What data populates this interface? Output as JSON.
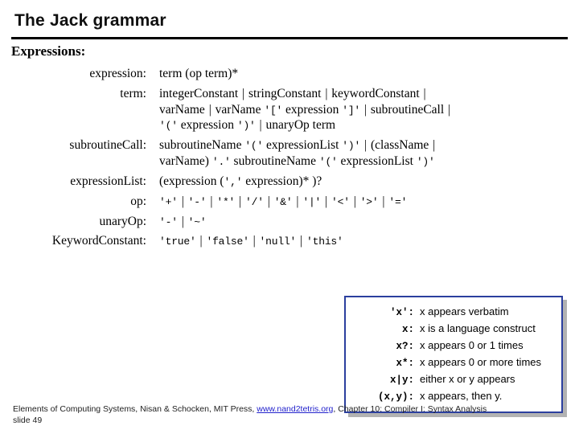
{
  "slide": {
    "title": "The Jack grammar",
    "section_heading": "Expressions:"
  },
  "grammar": {
    "rows": [
      {
        "lhs": "expression:",
        "rhs_html": "term (op term)*"
      },
      {
        "lhs": "term:",
        "rhs_html": "integerConstant <span class=\"bar\">|</span> stringConstant <span class=\"bar\">|</span> keywordConstant <span class=\"bar\">|</span><br>varName <span class=\"bar\">|</span> varName <span class=\"lit\">'['</span> expression <span class=\"lit\">']'</span> <span class=\"bar\">|</span> subroutineCall <span class=\"bar\">|</span><br><span class=\"lit\">'('</span> expression <span class=\"lit\">')'</span> <span class=\"bar\">|</span> unaryOp term"
      },
      {
        "lhs": "subroutineCall:",
        "rhs_html": "subroutineName <span class=\"lit\">'('</span> expressionList <span class=\"lit\">')'</span> <span class=\"bar\">|</span> (className <span class=\"bar\">|</span><br>varName) <span class=\"lit\">'.'</span> subroutineName <span class=\"lit\">'('</span> expressionList <span class=\"lit\">')'</span>"
      },
      {
        "lhs": "expressionList:",
        "rhs_html": "(expression (<span class=\"lit\">','</span> expression)* )?"
      },
      {
        "lhs": "op:",
        "rhs_html": "<span class=\"lit\">'+'</span> <span class=\"bar\">|</span> <span class=\"lit\">'-'</span> <span class=\"bar\">|</span> <span class=\"lit\">'*'</span> <span class=\"bar\">|</span> <span class=\"lit\">'/'</span> <span class=\"bar\">|</span> <span class=\"lit\">'&amp;'</span> <span class=\"bar\">|</span> <span class=\"lit\">'|'</span> <span class=\"bar\">|</span> <span class=\"lit\">'&lt;'</span> <span class=\"bar\">|</span> <span class=\"lit\">'&gt;'</span> <span class=\"bar\">|</span> <span class=\"lit\">'='</span>"
      },
      {
        "lhs": "unaryOp:",
        "rhs_html": "<span class=\"lit\">'-'</span> <span class=\"bar\">|</span> <span class=\"lit\">'~'</span>"
      },
      {
        "lhs": "KeywordConstant:",
        "rhs_html": "<span class=\"lit\">'true'</span> <span class=\"bar\">|</span> <span class=\"lit\">'false'</span> <span class=\"bar\">|</span> <span class=\"lit\">'null'</span> <span class=\"bar\">|</span> <span class=\"lit\">'this'</span>"
      }
    ]
  },
  "legend": {
    "border_color": "#2b3f9e",
    "rows": [
      {
        "symbol": "'x':",
        "description": "x appears verbatim"
      },
      {
        "symbol": "x:",
        "description": "x is a language construct"
      },
      {
        "symbol": "x?:",
        "description": "x appears 0 or 1 times"
      },
      {
        "symbol": "x*:",
        "description": "x appears 0 or more times"
      },
      {
        "symbol": "x|y:",
        "description": "either x or y appears"
      },
      {
        "symbol": "(x,y):",
        "description": "x appears, then y."
      }
    ]
  },
  "footer": {
    "line1_before_link": "Elements of Computing Systems, Nisan & Schocken, MIT Press,",
    "link_text": "www.nand2tetris.org",
    "line1_after_link": ", Chapter 10: Compiler I: Syntax Analysis",
    "line2": "slide 49"
  }
}
